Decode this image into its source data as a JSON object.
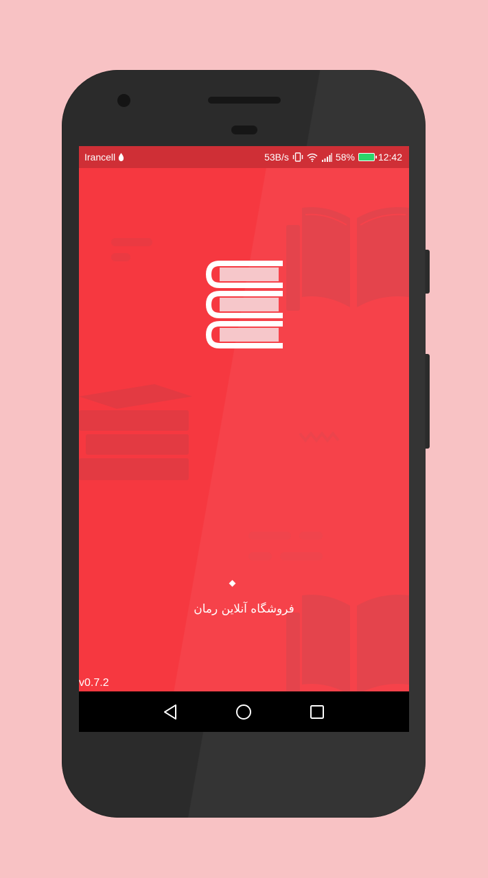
{
  "status_bar": {
    "carrier": "Irancell",
    "net_speed": "53B/s",
    "battery_percent": "58%",
    "time": "12:42",
    "icons": [
      "vibrate-icon",
      "wifi-icon",
      "signal-icon",
      "battery-charging-icon"
    ]
  },
  "splash": {
    "app_name": "فروشگاه آنلاین رمان",
    "version": "v0.7.2",
    "logo_icon": "books-stack-icon",
    "loading_indicator": "dot"
  },
  "nav_bar": {
    "buttons": [
      "back-icon",
      "home-icon",
      "recents-icon"
    ]
  },
  "colors": {
    "background": "#f8c2c4",
    "screen": "#f63840",
    "status_bar": "#cf2f36",
    "phone_body": "#2b2b2b",
    "nav_bar": "#000000"
  }
}
